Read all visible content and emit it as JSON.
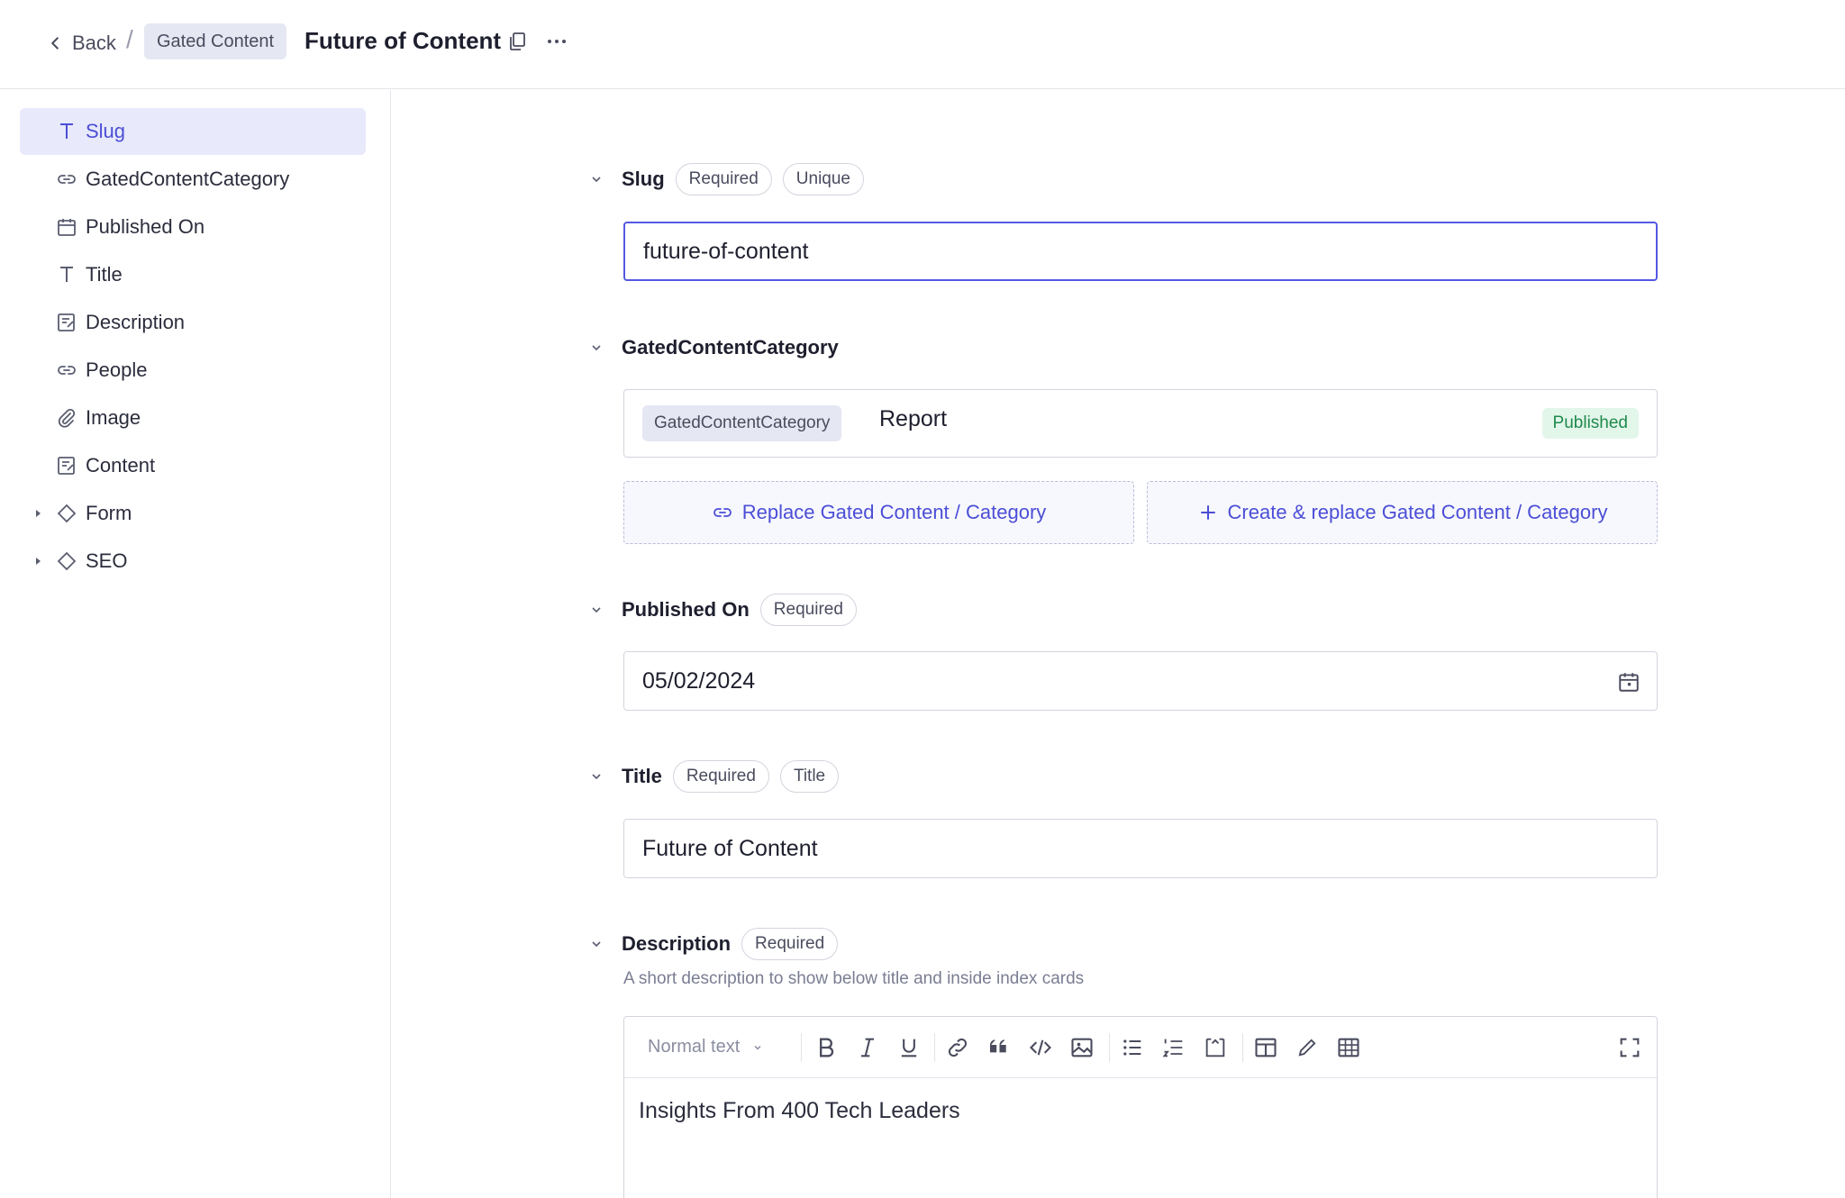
{
  "header": {
    "back_label": "Back",
    "breadcrumb": "Gated Content",
    "title": "Future of Content"
  },
  "sidebar": {
    "items": [
      {
        "label": "Slug",
        "icon": "text-icon"
      },
      {
        "label": "GatedContentCategory",
        "icon": "link-icon"
      },
      {
        "label": "Published On",
        "icon": "calendar-icon"
      },
      {
        "label": "Title",
        "icon": "text-icon"
      },
      {
        "label": "Description",
        "icon": "rich-text-icon"
      },
      {
        "label": "People",
        "icon": "link-icon"
      },
      {
        "label": "Image",
        "icon": "paperclip-icon"
      },
      {
        "label": "Content",
        "icon": "rich-text-icon"
      },
      {
        "label": "Form",
        "icon": "diamond-icon"
      },
      {
        "label": "SEO",
        "icon": "diamond-icon"
      }
    ]
  },
  "fields": {
    "slug": {
      "label": "Slug",
      "tags": [
        "Required",
        "Unique"
      ],
      "value": "future-of-content"
    },
    "category": {
      "label": "GatedContentCategory",
      "ref_type": "GatedContentCategory",
      "ref_name": "Report",
      "ref_status": "Published",
      "replace_label": "Replace Gated Content / Category",
      "create_label": "Create & replace Gated Content / Category"
    },
    "published_on": {
      "label": "Published On",
      "tags": [
        "Required"
      ],
      "value": "05/02/2024"
    },
    "title": {
      "label": "Title",
      "tags": [
        "Required",
        "Title"
      ],
      "value": "Future of Content"
    },
    "description": {
      "label": "Description",
      "tags": [
        "Required"
      ],
      "hint": "A short description to show below title and inside index cards",
      "format": "Normal text",
      "value": "Insights From 400 Tech Leaders"
    }
  },
  "colors": {
    "accent": "#5558e3",
    "active_bg": "#e8e9fb",
    "published_bg": "#e3f6ea",
    "published_text": "#1f8a4c"
  }
}
